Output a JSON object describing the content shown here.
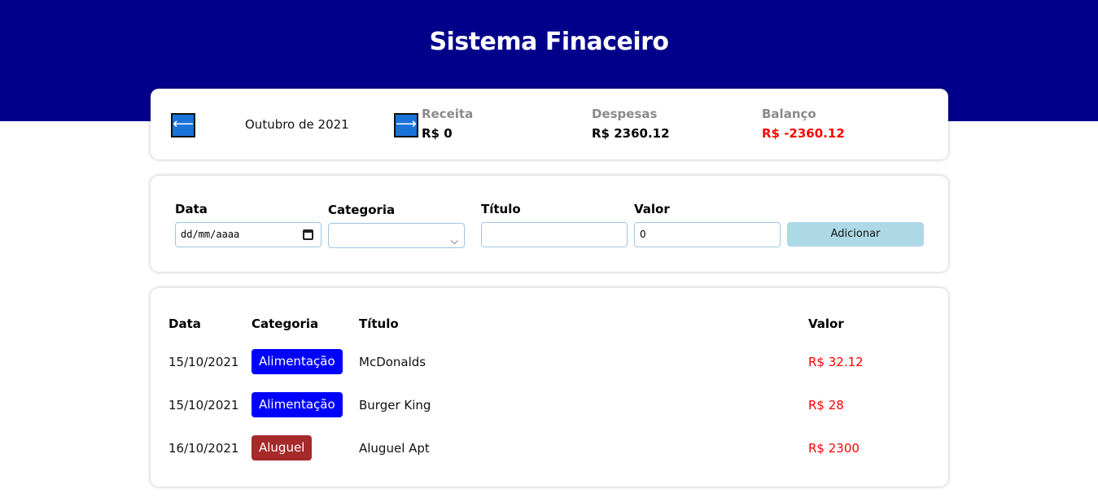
{
  "header": {
    "title": "Sistema Finaceiro",
    "color": "#00008b"
  },
  "summary": {
    "prev_icon": "arrow-left-icon",
    "next_icon": "arrow-right-icon",
    "prev_glyph": "⟵",
    "next_glyph": "⟶",
    "month": "Outubro de 2021",
    "receita_label": "Receita",
    "receita_value": "R$ 0",
    "despesas_label": "Despesas",
    "despesas_value": "R$ 2360.12",
    "balanco_label": "Balanço",
    "balanco_value": "R$ -2360.12"
  },
  "form": {
    "data_label": "Data",
    "data_value": "dd/mm/aaaa",
    "categoria_label": "Categoria",
    "categoria_value": "",
    "titulo_label": "Título",
    "titulo_value": "",
    "valor_label": "Valor",
    "valor_value": "0",
    "add_label": "Adicionar"
  },
  "table": {
    "headers": {
      "data": "Data",
      "categoria": "Categoria",
      "titulo": "Título",
      "valor": "Valor"
    },
    "rows": [
      {
        "data": "15/10/2021",
        "categoria": "Alimentação",
        "cat_color": "#0000ff",
        "titulo": "McDonalds",
        "valor": "R$ 32.12"
      },
      {
        "data": "15/10/2021",
        "categoria": "Alimentação",
        "cat_color": "#0000ff",
        "titulo": "Burger King",
        "valor": "R$ 28"
      },
      {
        "data": "16/10/2021",
        "categoria": "Aluguel",
        "cat_color": "#a52a2a",
        "titulo": "Aluguel Apt",
        "valor": "R$ 2300"
      }
    ]
  }
}
